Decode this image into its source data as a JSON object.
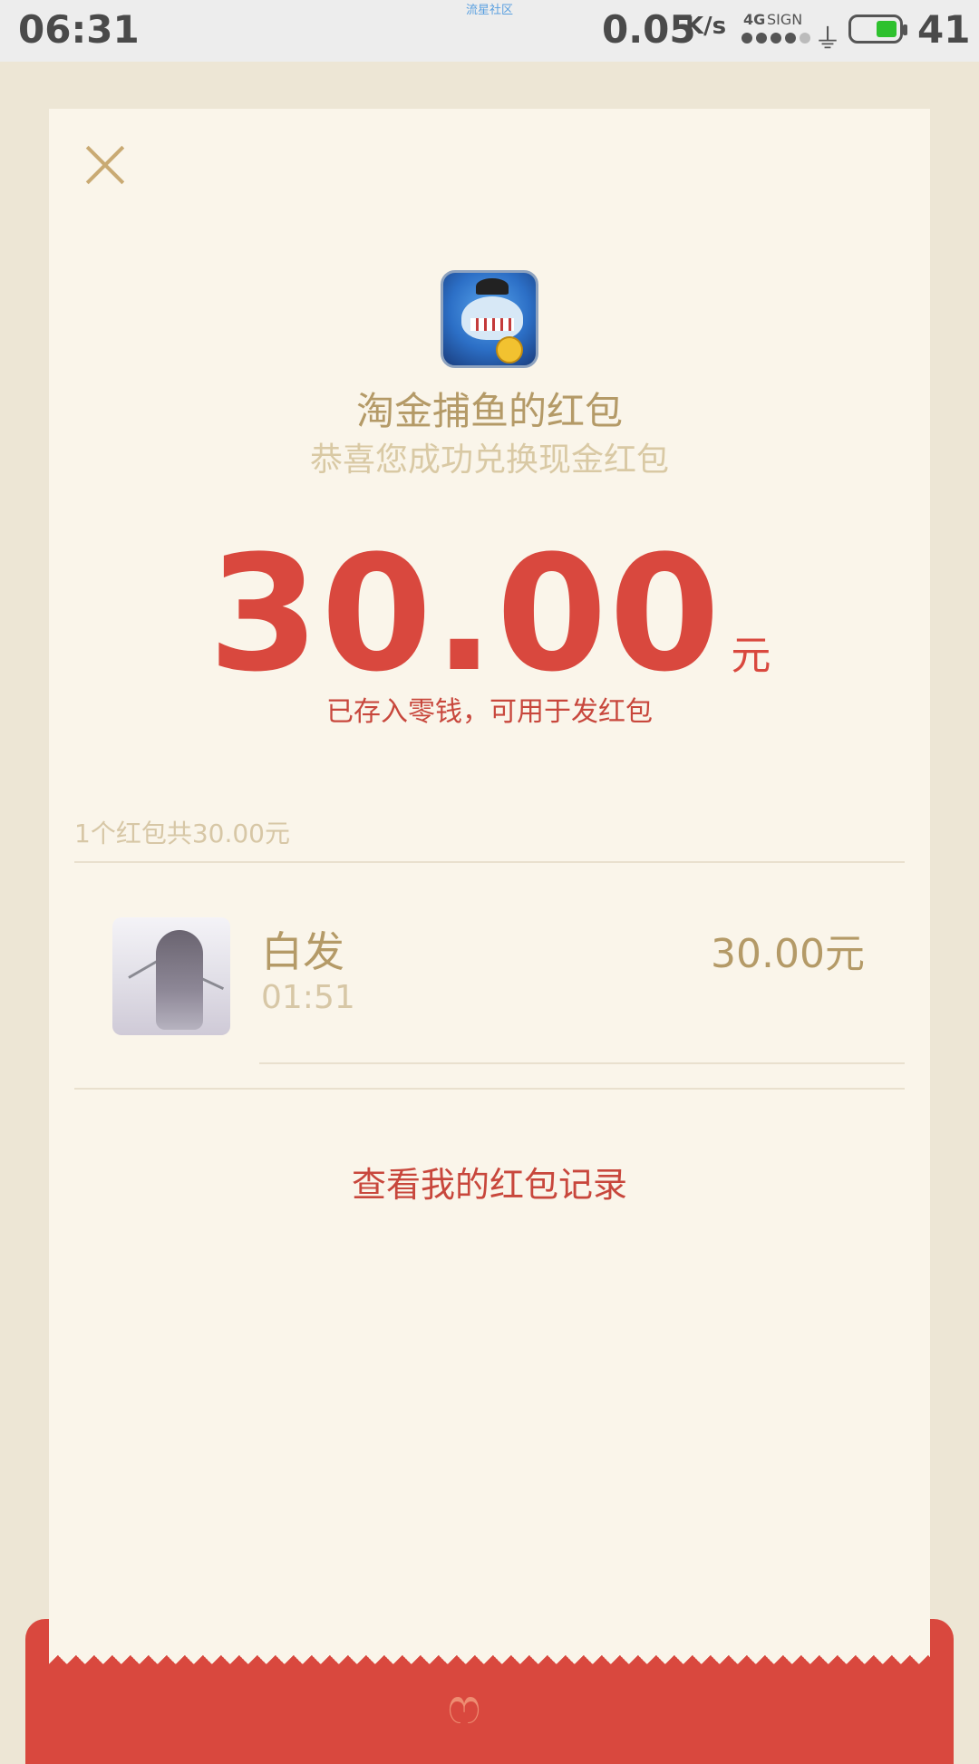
{
  "status_bar": {
    "time": "06:31",
    "watermark": "流星社区",
    "net_speed": "0.05",
    "net_speed_unit": "K/s",
    "network_type": "4G",
    "sign_label": "SIGN",
    "battery_level": "41",
    "battery_color": "#2ec12e"
  },
  "close_icon": "close-icon",
  "app": {
    "icon": "fishing-game-app-icon",
    "title": "淘金捕鱼的红包",
    "subtitle": "恭喜您成功兑换现金红包"
  },
  "amount": {
    "value": "30.00",
    "unit": "元",
    "note": "已存入零钱，可用于发红包",
    "accent_color": "#d9483e"
  },
  "summary": "1个红包共30.00元",
  "records": [
    {
      "name": "白发",
      "time": "01:51",
      "amount": "30.00元"
    }
  ],
  "link": {
    "label": "查看我的红包记录"
  },
  "envelope_logo": "red-envelope-logo-icon"
}
